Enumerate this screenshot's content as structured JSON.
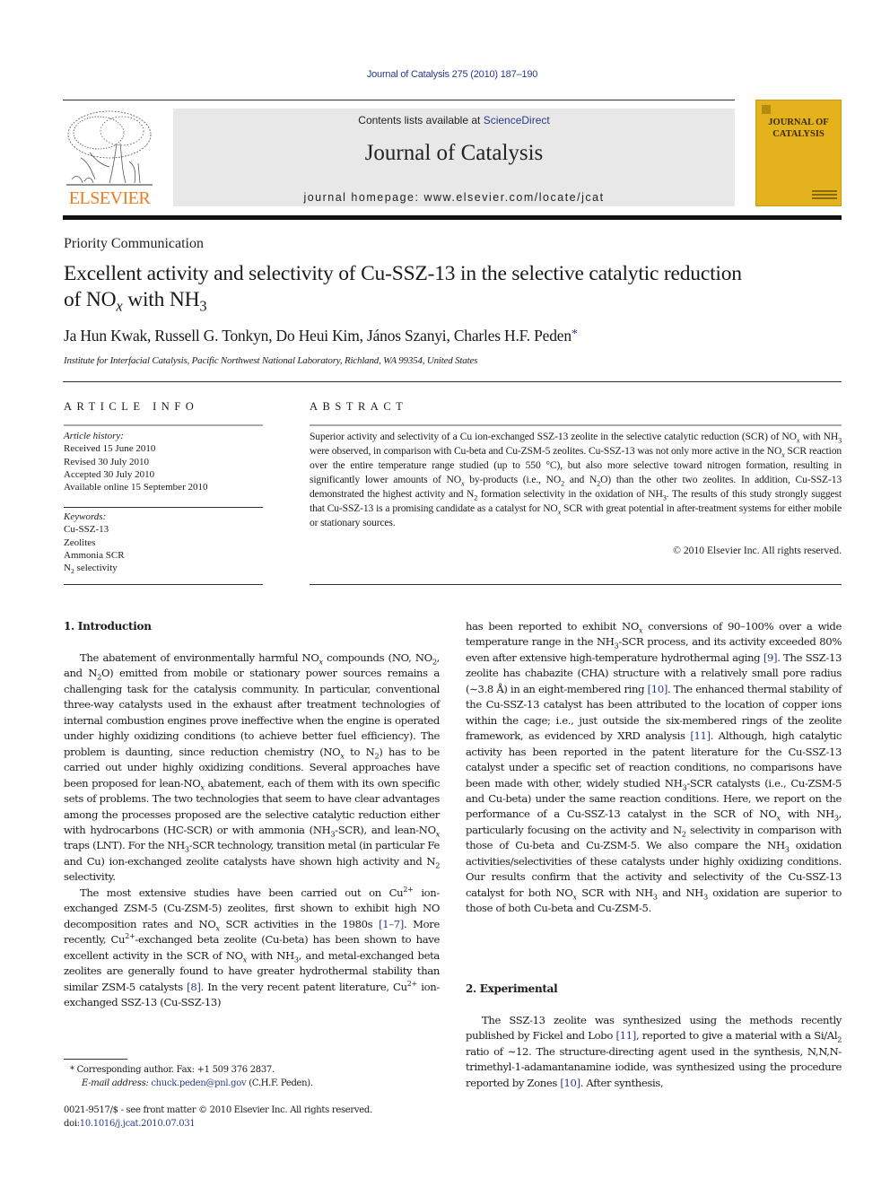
{
  "header": {
    "citation": "Journal of Catalysis 275 (2010) 187–190",
    "contents_prefix": "Contents lists available at ",
    "contents_link": "ScienceDirect",
    "journal_name": "Journal of Catalysis",
    "homepage": "journal homepage: www.elsevier.com/locate/jcat",
    "publisher_logo_text": "ELSEVIER",
    "cover_title_line1": "JOURNAL OF",
    "cover_title_line2": "CATALYSIS",
    "colors": {
      "link": "#2b3a8c",
      "elsevier_orange": "#f07b1d",
      "cover_gold": "#e3b21c",
      "masthead_gray": "#e8e8e8"
    }
  },
  "article": {
    "type": "Priority Communication",
    "title_line1": "Excellent activity and selectivity of Cu-SSZ-13 in the selective catalytic reduction",
    "title_line2_a": "of NO",
    "title_line2_sub_x": "x",
    "title_line2_b": " with NH",
    "title_line2_sub_3": "3",
    "authors": "Ja Hun Kwak, Russell G. Tonkyn, Do Heui Kim, János Szanyi, Charles H.F. Peden",
    "corresponding_mark": "*",
    "affiliation": "Institute for Interfacial Catalysis, Pacific Northwest National Laboratory, Richland, WA 99354, United States"
  },
  "article_info": {
    "heading": "ARTICLE INFO",
    "history_label": "Article history:",
    "history": [
      "Received 15 June 2010",
      "Revised 30 July 2010",
      "Accepted 30 July 2010",
      "Available online 15 September 2010"
    ],
    "keywords_label": "Keywords:",
    "keywords": [
      "Cu-SSZ-13",
      "Zeolites",
      "Ammonia SCR"
    ],
    "keyword_last_a": "N",
    "keyword_last_sub": "2",
    "keyword_last_b": " selectivity"
  },
  "abstract": {
    "heading": "ABSTRACT",
    "t1": "Superior activity and selectivity of a Cu ion-exchanged SSZ-13 zeolite in the selective catalytic reduction (SCR) of NO",
    "t2": " with NH",
    "t3": " were observed, in comparison with Cu-beta and Cu-ZSM-5 zeolites. Cu-SSZ-13 was not only more active in the NO",
    "t4": " SCR reaction over the entire temperature range studied (up to 550 °C), but also more selective toward nitrogen formation, resulting in significantly lower amounts of NO",
    "t5": " by-products (i.e., NO",
    "t6": " and N",
    "t7": "O) than the other two zeolites. In addition, Cu-SSZ-13 demonstrated the highest activity and N",
    "t8": " formation selectivity in the oxidation of NH",
    "t9": ". The results of this study strongly suggest that Cu-SSZ-13 is a promising candidate as a catalyst for NO",
    "t10": " SCR with great potential in after-treatment systems for either mobile or stationary sources.",
    "copyright": "© 2010 Elsevier Inc. All rights reserved."
  },
  "sections": {
    "intro_heading": "1. Introduction",
    "exp_heading": "2. Experimental"
  },
  "intro_p1": {
    "a": "The abatement of environmentally harmful NO",
    "b": " compounds (NO, NO",
    "c": ", and N",
    "d": "O) emitted from mobile or stationary power sources remains a challenging task for the catalysis community. In particular, conventional three-way catalysts used in the exhaust after treatment technologies of internal combustion engines prove ineffective when the engine is operated under highly oxidizing conditions (to achieve better fuel efficiency). The problem is daunting, since reduction chemistry (NO",
    "e": " to N",
    "f": ") has to be carried out under highly oxidizing conditions. Several approaches have been proposed for lean-NO",
    "g": " abatement, each of them with its own specific sets of problems. The two technologies that seem to have clear advantages among the processes proposed are the selective catalytic reduction either with hydrocarbons (HC-SCR) or with ammonia (NH",
    "h": "-SCR), and lean-NO",
    "i": " traps (LNT). For the NH",
    "j": "-SCR technology, transition metal (in particular Fe and Cu) ion-exchanged zeolite catalysts have shown high activity and N",
    "k": " selectivity."
  },
  "intro_p2": {
    "a": "The most extensive studies have been carried out on Cu",
    "b": " ion-exchanged ZSM-5 (Cu-ZSM-5) zeolites, first shown to exhibit high NO decomposition rates and NO",
    "c": " SCR activities in the 1980s ",
    "ref1": "[1–7]",
    "d": ". More recently, Cu",
    "e": "-exchanged beta zeolite (Cu-beta) has been shown to have excellent activity in the SCR of NO",
    "f": " with NH",
    "g": ", and metal-exchanged beta zeolites are generally found to have greater hydrothermal stability than similar ZSM-5 catalysts ",
    "ref2": "[8]",
    "h": ". In the very recent patent literature, Cu",
    "i": " ion-exchanged SSZ-13 (Cu-SSZ-13)"
  },
  "right_col": {
    "a": "has been reported to exhibit NO",
    "b": " conversions of 90–100% over a wide temperature range in the NH",
    "c": "-SCR process, and its activity exceeded 80% even after extensive high-temperature hydrothermal aging ",
    "ref9": "[9]",
    "d": ". The SSZ-13 zeolite has chabazite (CHA) structure with a relatively small pore radius (∼3.8 Å) in an eight-membered ring ",
    "ref10": "[10]",
    "e": ". The enhanced thermal stability of the Cu-SSZ-13 catalyst has been attributed to the location of copper ions within the cage; i.e., just outside the six-membered rings of the zeolite framework, as evidenced by XRD analysis ",
    "ref11": "[11]",
    "f": ". Although, high catalytic activity has been reported in the patent literature for the Cu-SSZ-13 catalyst under a specific set of reaction conditions, no comparisons have been made with other, widely studied NH",
    "g": "-SCR catalysts (i.e., Cu-ZSM-5 and Cu-beta) under the same reaction conditions. Here, we report on the performance of a Cu-SSZ-13 catalyst in the SCR of NO",
    "h": " with NH",
    "i": ", particularly focusing on the activity and N",
    "j": " selectivity in comparison with those of Cu-beta and Cu-ZSM-5. We also compare the NH",
    "k": " oxidation activities/selectivities of these catalysts under highly oxidizing conditions. Our results confirm that the activity and selectivity of the Cu-SSZ-13 catalyst for both NO",
    "l": " SCR with NH",
    "m": " and NH",
    "n": " oxidation are superior to those of both Cu-beta and Cu-ZSM-5."
  },
  "exp_p1": {
    "a": "The SSZ-13 zeolite was synthesized using the methods recently published by Fickel and Lobo ",
    "ref11": "[11]",
    "b": ", reported to give a material with a Si/Al",
    "c": " ratio of ∼12. The structure-directing agent used in the synthesis, N,N,N-trimethyl-1-adamantanamine iodide, was synthesized using the procedure reported by Zones ",
    "ref10": "[10]",
    "d": ". After synthesis,"
  },
  "sub": {
    "x": "x",
    "two": "2",
    "three": "3",
    "plus2": "2+"
  },
  "footnote": {
    "mark": "*",
    "text": " Corresponding author. Fax: +1 509 376 2837.",
    "email_label": "E-mail address: ",
    "email": "chuck.peden@pnl.gov",
    "email_suffix": " (C.H.F. Peden)."
  },
  "front_matter": {
    "line1": "0021-9517/$ - see front matter © 2010 Elsevier Inc. All rights reserved.",
    "doi_label": "doi:",
    "doi": "10.1016/j.jcat.2010.07.031"
  }
}
